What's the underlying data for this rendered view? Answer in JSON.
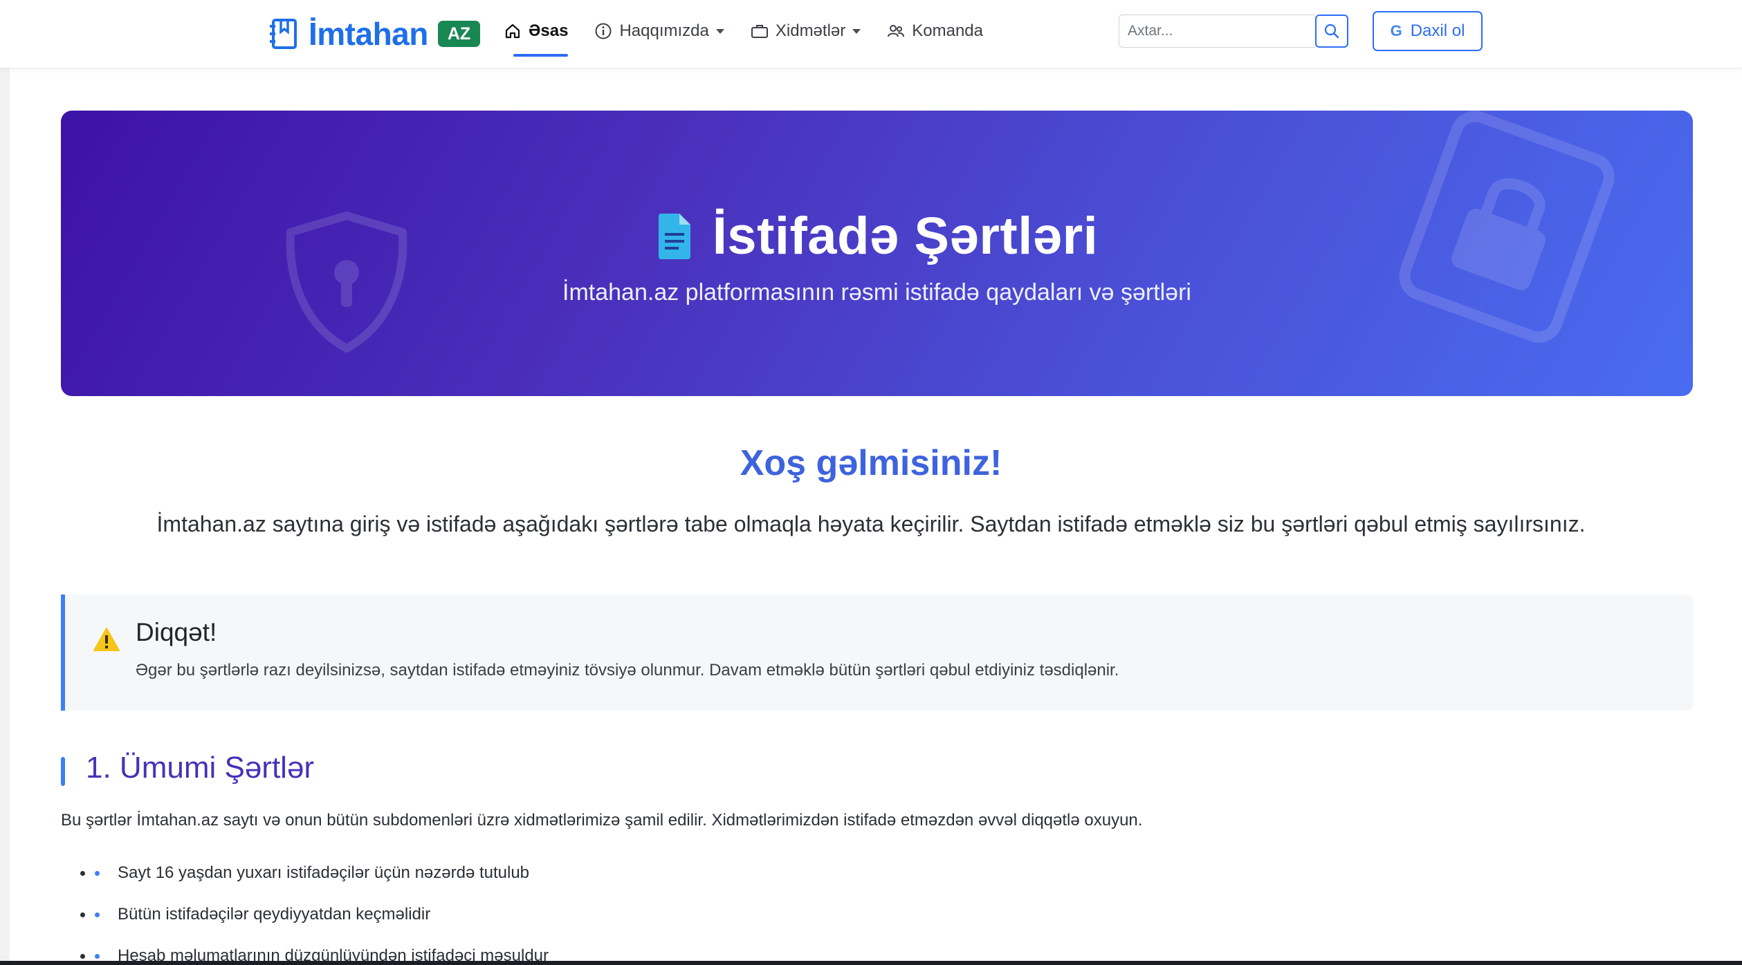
{
  "brand": {
    "name": "İmtahan",
    "badge": "AZ"
  },
  "nav": [
    {
      "label": "Əsas",
      "icon": "home-icon",
      "active": true
    },
    {
      "label": "Haqqımızda",
      "icon": "info-icon",
      "dropdown": true
    },
    {
      "label": "Xidmətlər",
      "icon": "briefcase-icon",
      "dropdown": true
    },
    {
      "label": "Komanda",
      "icon": "users-icon"
    }
  ],
  "search": {
    "placeholder": "Axtar..."
  },
  "login": {
    "label": "Daxil ol",
    "icon": "google-icon"
  },
  "hero": {
    "title": "İstifadə Şərtləri",
    "subtitle": "İmtahan.az platformasının rəsmi istifadə qaydaları və şərtləri"
  },
  "welcome": {
    "title": "Xoş gəlmisiniz!",
    "text": "İmtahan.az saytına giriş və istifadə aşağıdakı şərtlərə tabe olmaqla həyata keçirilir. Saytdan istifadə etməklə siz bu şərtləri qəbul etmiş sayılırsınız."
  },
  "alert": {
    "title": "Diqqət!",
    "text": "Əgər bu şərtlərlə razı deyilsinizsə, saytdan istifadə etməyiniz tövsiyə olunmur. Davam etməklə bütün şərtləri qəbul etdiyiniz təsdiqlənir."
  },
  "section1": {
    "title": "1. Ümumi Şərtlər",
    "text": "Bu şərtlər İmtahan.az saytı və onun bütün subdomenləri üzrə xidmətlərimizə şamil edilir. Xidmətlərimizdən istifadə etməzdən əvvəl diqqətlə oxuyun.",
    "items": [
      "Sayt 16 yaşdan yuxarı istifadəçilər üçün nəzərdə tutulub",
      "Bütün istifadəçilər qeydiyyatdan keçməlidir",
      "Hesab məlumatlarının düzgünlüyündən istifadəçi məsuldur"
    ]
  },
  "colors": {
    "accent": "#2d6df6",
    "badge": "#198754",
    "heading": "#3e63dd",
    "section": "#4632b8"
  }
}
